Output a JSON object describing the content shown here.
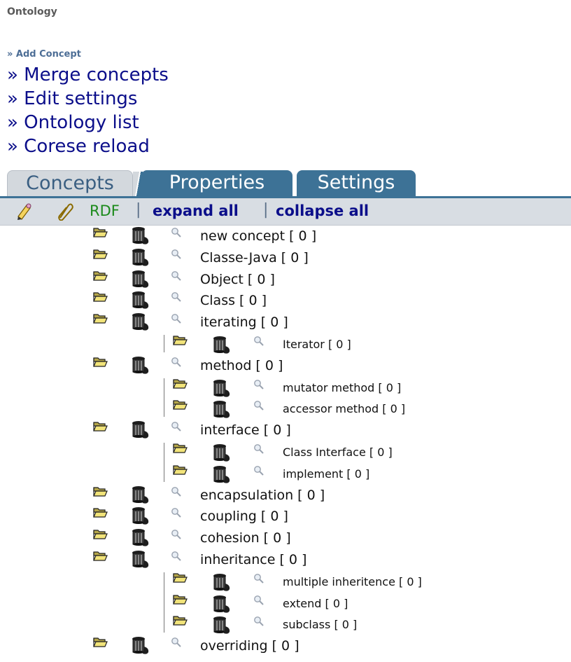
{
  "page": {
    "title": "Ontology"
  },
  "actions": {
    "add_concept": "» Add Concept",
    "merge_concepts": "» Merge concepts",
    "edit_settings": "» Edit settings",
    "ontology_list": "» Ontology list",
    "corese_reload": "» Corese reload"
  },
  "tabs": {
    "concepts": "Concepts",
    "properties": "Properties",
    "settings": "Settings"
  },
  "toolbar": {
    "rdf": "RDF",
    "separator": "|",
    "expand_all": "expand all",
    "collapse_all": "collapse all",
    "icons": [
      "edit-pencil-icon",
      "clip-icon"
    ]
  },
  "tree_icons": [
    "open-folder-icon",
    "trash-can-icon",
    "magnifier-icon"
  ],
  "tree": [
    {
      "label": "new concept [ 0 ]",
      "level": 0
    },
    {
      "label": "Classe-Java [ 0 ]",
      "level": 0
    },
    {
      "label": "Object [ 0 ]",
      "level": 0
    },
    {
      "label": "Class [ 0 ]",
      "level": 0
    },
    {
      "label": "iterating [ 0 ]",
      "level": 0
    },
    {
      "label": "Iterator [ 0 ]",
      "level": 1
    },
    {
      "label": "method [ 0 ]",
      "level": 0
    },
    {
      "label": "mutator method [ 0 ]",
      "level": 1
    },
    {
      "label": "accessor method [ 0 ]",
      "level": 1
    },
    {
      "label": "interface [ 0 ]",
      "level": 0
    },
    {
      "label": "Class Interface [ 0 ]",
      "level": 1
    },
    {
      "label": "implement [ 0 ]",
      "level": 1
    },
    {
      "label": "encapsulation [ 0 ]",
      "level": 0
    },
    {
      "label": "coupling [ 0 ]",
      "level": 0
    },
    {
      "label": "cohesion [ 0 ]",
      "level": 0
    },
    {
      "label": "inheritance [ 0 ]",
      "level": 0
    },
    {
      "label": "multiple inheritence [ 0 ]",
      "level": 1
    },
    {
      "label": "extend [ 0 ]",
      "level": 1
    },
    {
      "label": "subclass [ 0 ]",
      "level": 1
    },
    {
      "label": "overriding [ 0 ]",
      "level": 0
    }
  ],
  "colors": {
    "link": "#0b0e8a",
    "small_link": "#4d6e96",
    "tab_active_bg": "#d3d8dd",
    "tab_bg": "#3d7296",
    "toolbar_bg": "#d8dde3",
    "rdf": "#1b8a1b"
  }
}
